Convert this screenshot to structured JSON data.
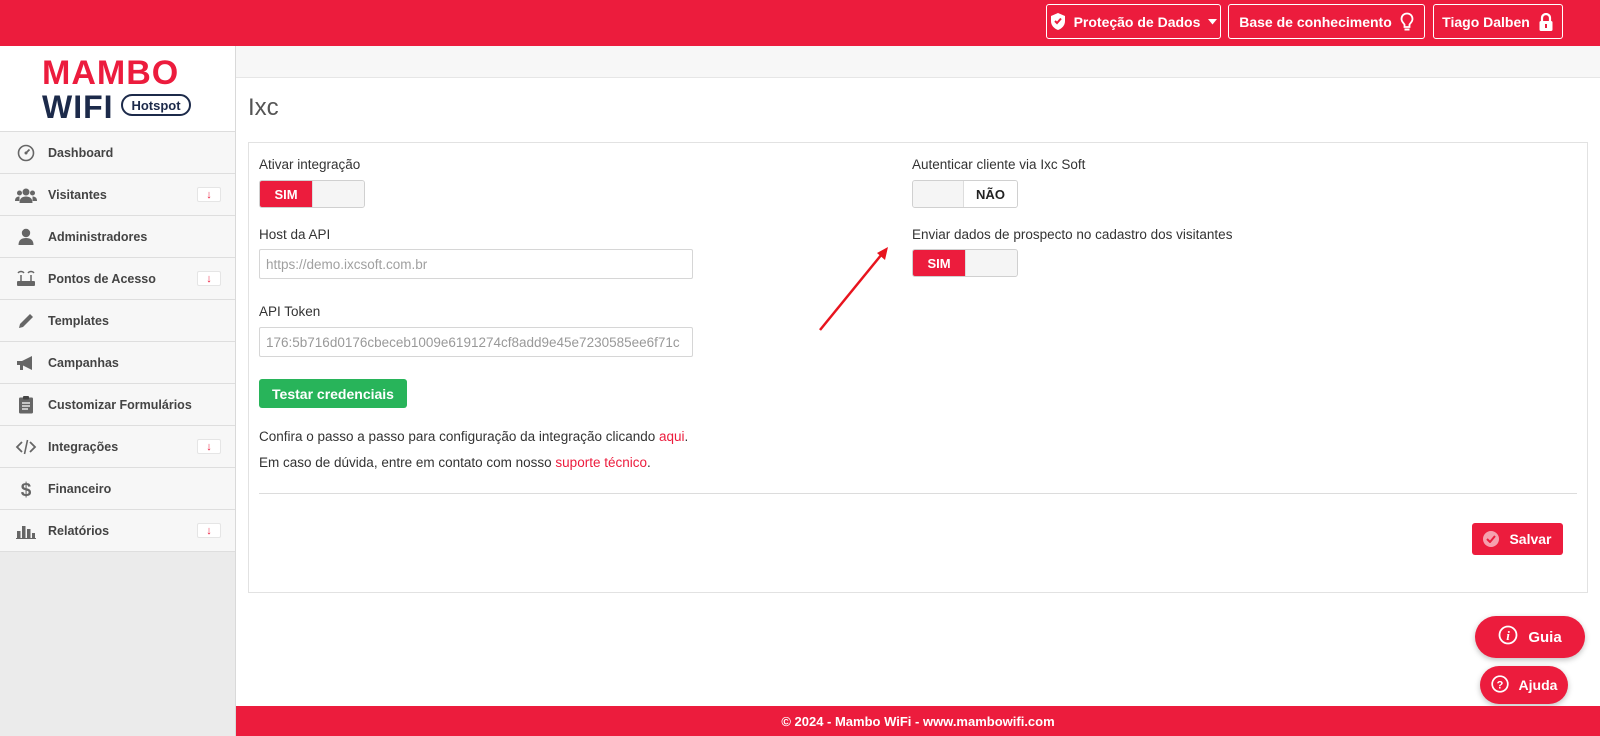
{
  "topbar": {
    "data_protection": "Proteção de Dados",
    "knowledge_base": "Base de conhecimento",
    "user_name": "Tiago Dalben"
  },
  "logo": {
    "line1": "MAMBO",
    "line2": "WIFI",
    "badge": "Hotspot"
  },
  "sidebar": {
    "items": [
      {
        "label": "Dashboard",
        "icon": "dashboard-icon",
        "expandable": false
      },
      {
        "label": "Visitantes",
        "icon": "users-icon",
        "expandable": true
      },
      {
        "label": "Administradores",
        "icon": "user-icon",
        "expandable": false
      },
      {
        "label": "Pontos de Acesso",
        "icon": "router-icon",
        "expandable": true
      },
      {
        "label": "Templates",
        "icon": "pencil-icon",
        "expandable": false
      },
      {
        "label": "Campanhas",
        "icon": "megaphone-icon",
        "expandable": false
      },
      {
        "label": "Customizar Formulários",
        "icon": "clipboard-icon",
        "expandable": false
      },
      {
        "label": "Integrações",
        "icon": "code-icon",
        "expandable": true
      },
      {
        "label": "Financeiro",
        "icon": "dollar-icon",
        "expandable": false
      },
      {
        "label": "Relatórios",
        "icon": "bar-chart-icon",
        "expandable": true
      }
    ],
    "caret_glyph": "↓"
  },
  "page": {
    "title": "Ixc"
  },
  "form": {
    "enable_integration_label": "Ativar integração",
    "enable_integration_value": "SIM",
    "api_host_label": "Host da API",
    "api_host_placeholder": "https://demo.ixcsoft.com.br",
    "api_token_label": "API Token",
    "api_token_value": "176:5b716d0176cbeceb1009e6191274cf8add9e45e7230585ee6f71c",
    "test_button": "Testar credenciais",
    "help_text_1": "Confira o passo a passo para configuração da integração clicando ",
    "help_link_1": "aqui",
    "help_text_1_end": ".",
    "help_text_2": "Em caso de dúvida, entre em contato com nosso ",
    "help_link_2": "suporte técnico",
    "help_text_2_end": ".",
    "auth_client_label": "Autenticar cliente via Ixc Soft",
    "auth_client_value": "NÃO",
    "send_prospect_label": "Enviar dados de prospecto no cadastro dos visitantes",
    "send_prospect_value": "SIM",
    "save_button": "Salvar"
  },
  "floating": {
    "guide": "Guia",
    "help": "Ajuda"
  },
  "footer": {
    "text": "© 2024 - Mambo WiFi - www.mambowifi.com"
  },
  "colors": {
    "brand_red": "#ec1c3d",
    "success_green": "#28b45a",
    "logo_navy": "#1c2a4a"
  }
}
